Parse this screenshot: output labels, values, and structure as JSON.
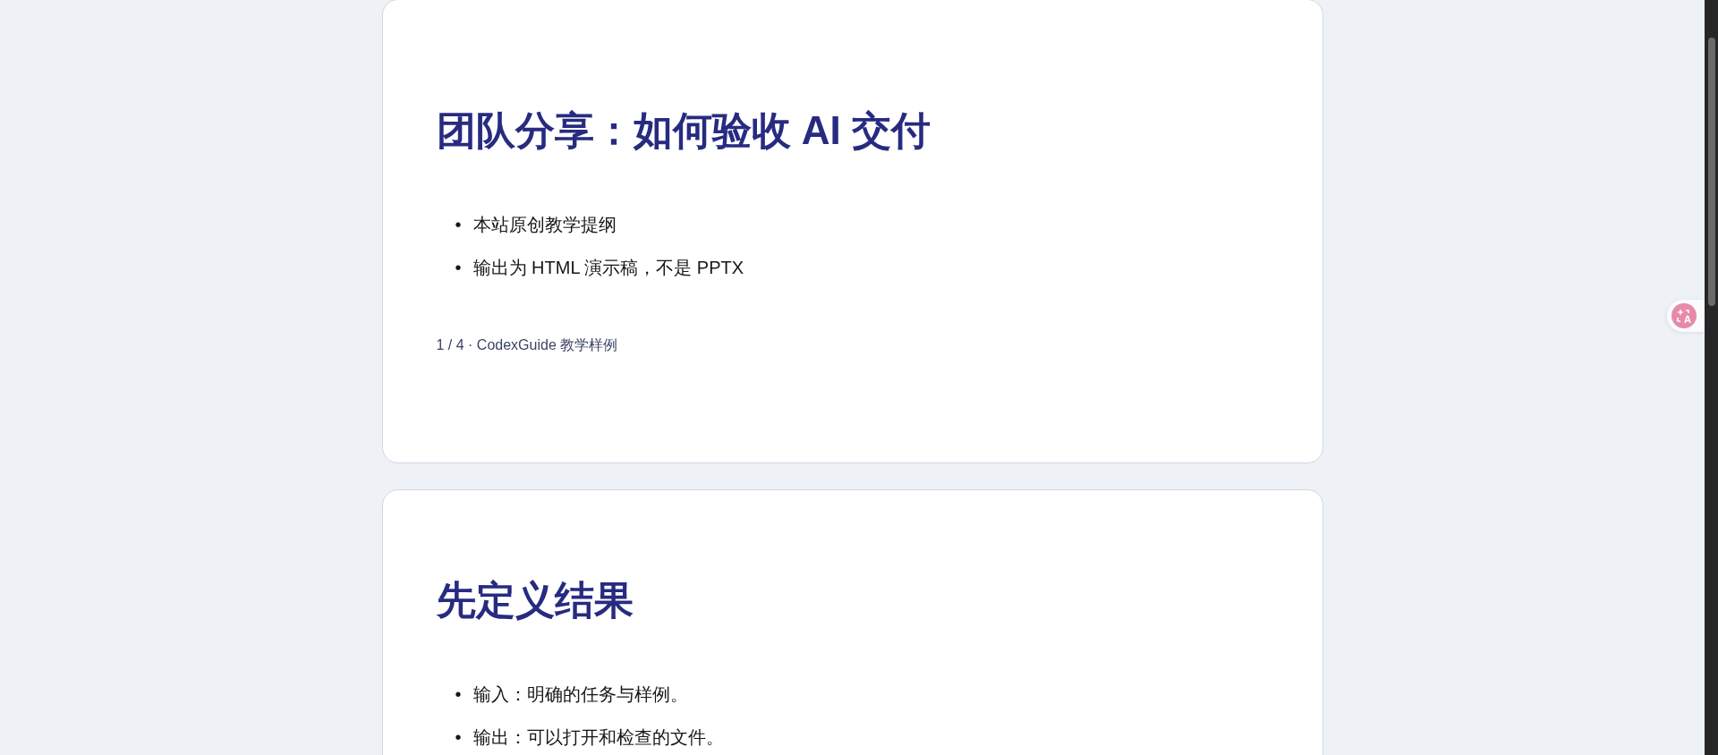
{
  "slides": [
    {
      "title": "团队分享：如何验收 AI 交付",
      "bullets": [
        {
          "marker": "•",
          "text": "本站原创教学提纲"
        },
        {
          "marker": "•",
          "text": "输出为 HTML 演示稿，不是 PPTX"
        }
      ],
      "footer": "1 / 4 · CodexGuide 教学样例"
    },
    {
      "title": "先定义结果",
      "bullets": [
        {
          "marker": "•",
          "text": "输入：明确的任务与样例。"
        },
        {
          "marker": "•",
          "text": "输出：可以打开和检查的文件。"
        }
      ]
    }
  ]
}
